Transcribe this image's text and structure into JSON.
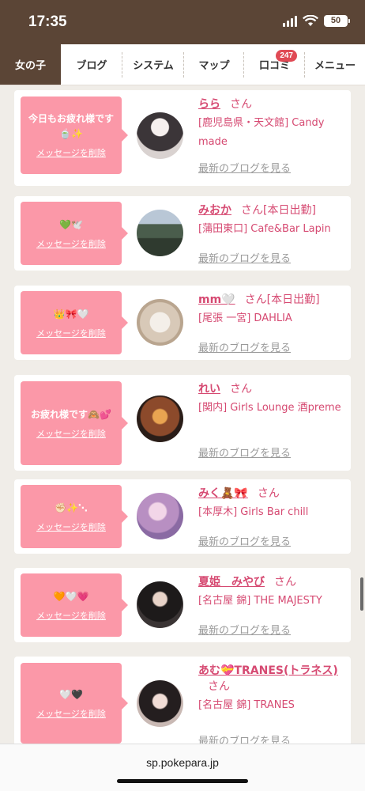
{
  "status_bar": {
    "time": "17:35",
    "battery": "50"
  },
  "nav": {
    "tabs": [
      {
        "label": "女の子",
        "active": true
      },
      {
        "label": "ブログ"
      },
      {
        "label": "システム"
      },
      {
        "label": "マップ"
      },
      {
        "label": "口コミ",
        "badge": "247"
      },
      {
        "label": "メニュー"
      }
    ]
  },
  "cards": [
    {
      "message": "今日もお疲れ様です🍵✨",
      "delete_label": "メッセージを削除",
      "name": "らら",
      "status": "",
      "san": "さん",
      "shop": "[鹿児島県・天文館] Candy made",
      "blog_label": "最新のブログを見る"
    },
    {
      "message": "💚🕊️",
      "delete_label": "メッセージを削除",
      "name": "みおか",
      "status": "[本日出勤]",
      "san": "さん",
      "shop": "[蒲田東口] Cafe&Bar Lapin",
      "blog_label": "最新のブログを見る"
    },
    {
      "message": "👑🎀🤍",
      "delete_label": "メッセージを削除",
      "name": "mm🤍",
      "status": "[本日出勤]",
      "san": "さん",
      "shop": "[尾張 一宮] DAHLIA",
      "blog_label": "最新のブログを見る"
    },
    {
      "message": "お疲れ様です🙈💕",
      "delete_label": "メッセージを削除",
      "name": "れい",
      "status": "",
      "san": "さん",
      "shop": "[関内] Girls Lounge 酒preme",
      "blog_label": "最新のブログを見る"
    },
    {
      "message": "✊🏻✨⋱",
      "delete_label": "メッセージを削除",
      "name": "みく🧸🎀",
      "status": "",
      "san": "さん",
      "shop": "[本厚木] Girls Bar chill",
      "blog_label": "最新のブログを見る"
    },
    {
      "message": "🧡🤍💗",
      "delete_label": "メッセージを削除",
      "name": "夏姫　みやび",
      "status": "",
      "san": "さん",
      "shop": "[名古屋 錦] THE MAJESTY",
      "blog_label": "最新のブログを見る"
    },
    {
      "message": "🤍🖤",
      "delete_label": "メッセージを削除",
      "name": "あむ💝TRANES(トラネス)",
      "status": "",
      "san": "さん",
      "shop": "[名古屋 錦] TRANES",
      "blog_label": "最新のブログを見る"
    }
  ],
  "url_bar": {
    "url": "sp.pokepara.jp"
  },
  "colors": {
    "accent_pink": "#fb98a8",
    "name_pink": "#d64a72",
    "brown": "#5b4536"
  }
}
